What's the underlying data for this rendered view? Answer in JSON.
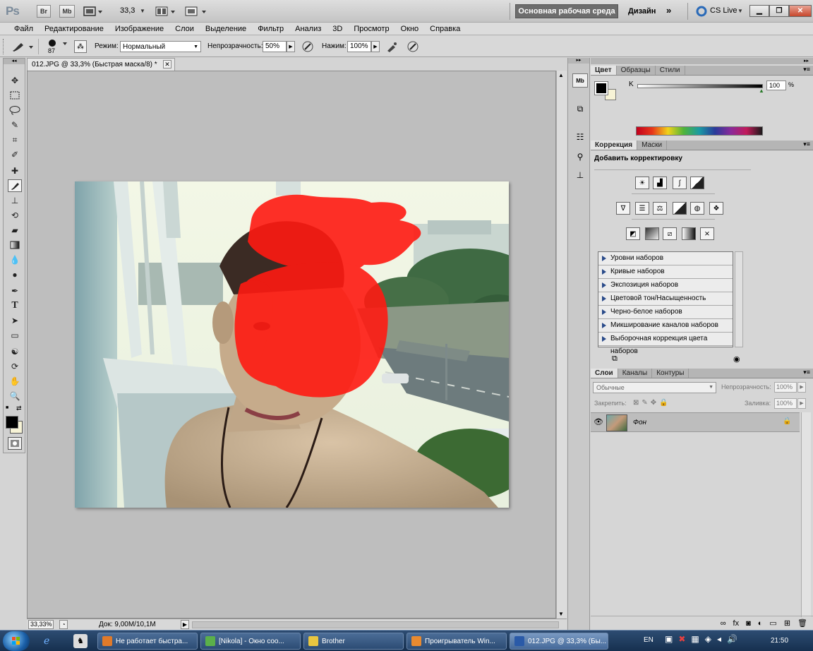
{
  "app": {
    "logo": "Ps"
  },
  "titlebar": {
    "br_label": "Br",
    "mb_label": "Mb",
    "zoom": "33,3",
    "workspace_active": "Основная рабочая среда",
    "workspace_design": "Дизайн",
    "more": "»",
    "cslive": "CS Live"
  },
  "menu": [
    "Файл",
    "Редактирование",
    "Изображение",
    "Слои",
    "Выделение",
    "Фильтр",
    "Анализ",
    "3D",
    "Просмотр",
    "Окно",
    "Справка"
  ],
  "options": {
    "brush_size": "87",
    "mode_label": "Режим:",
    "mode_value": "Нормальный",
    "opacity_label": "Непрозрачность:",
    "opacity_value": "50%",
    "flow_label": "Нажим:",
    "flow_value": "100%"
  },
  "document": {
    "tab_title": "012.JPG @ 33,3% (Быстрая маска/8) *",
    "zoom_status": "33,33%",
    "doc_info": "Док: 9,00M/10,1M"
  },
  "color_panel": {
    "tabs": [
      "Цвет",
      "Образцы",
      "Стили"
    ],
    "channel_label": "K",
    "channel_value": "100",
    "unit": "%",
    "foreground": "#000000",
    "background": "#f7f3d6"
  },
  "adjustments_panel": {
    "tabs": [
      "Коррекция",
      "Маски"
    ],
    "title": "Добавить корректировку",
    "presets": [
      "Уровни наборов",
      "Кривые наборов",
      "Экспозиция наборов",
      "Цветовой тон/Насыщенность наборов",
      "Черно-белое наборов",
      "Микширование каналов наборов",
      "Выборочная коррекция цвета наборов"
    ]
  },
  "layers_panel": {
    "tabs": [
      "Слои",
      "Каналы",
      "Контуры"
    ],
    "blend_mode": "Обычные",
    "opacity_label": "Непрозрачность:",
    "opacity_value": "100%",
    "lock_label": "Закрепить:",
    "fill_label": "Заливка:",
    "fill_value": "100%",
    "layers": [
      {
        "name": "Фон",
        "visible": true,
        "locked": true
      }
    ]
  },
  "taskbar": {
    "tasks": [
      {
        "label": "Не работает быстра...",
        "icon_color": "#e07a2a"
      },
      {
        "label": "[Nikola] - Окно соо...",
        "icon_color": "#5bb04a"
      },
      {
        "label": "Brother",
        "icon_color": "#e8c640"
      },
      {
        "label": "Проигрыватель Win...",
        "icon_color": "#e88a30"
      },
      {
        "label": "012.JPG @ 33,3% (Бы...",
        "icon_color": "#2a5aa8"
      }
    ],
    "lang": "EN",
    "time": "21:50"
  }
}
